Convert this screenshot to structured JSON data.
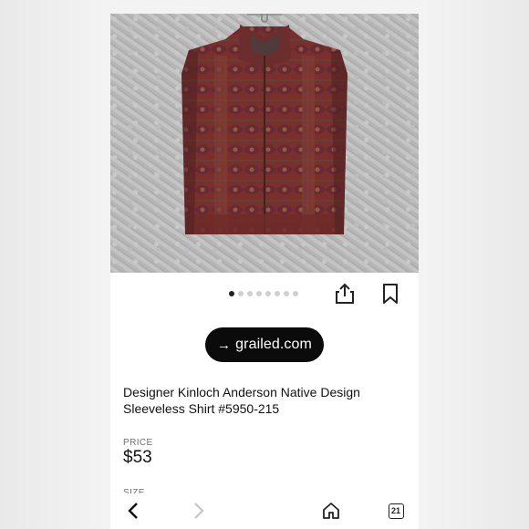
{
  "carousel": {
    "total": 8,
    "active_index": 0
  },
  "link": {
    "arrow": "→",
    "label": "grailed.com"
  },
  "product": {
    "title": "Designer Kinloch Anderson Native Design Sleeveless Shirt #5950-215",
    "price_label": "PRICE",
    "price": "$53",
    "size_label": "SIZE"
  },
  "browser": {
    "tab_count": "21"
  },
  "icons": {
    "share": "share-icon",
    "bookmark": "bookmark-icon",
    "back": "chevron-left-icon",
    "forward": "chevron-right-icon",
    "home": "home-icon",
    "tabs": "tabs-icon"
  },
  "colors": {
    "pill_bg": "#0b0b0b",
    "text": "#111111",
    "muted": "#6f6f6f",
    "vest_base": "#7a2f2a"
  }
}
